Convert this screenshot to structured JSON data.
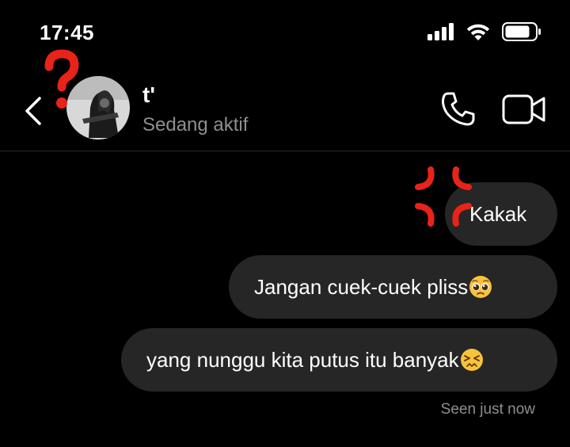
{
  "status_bar": {
    "time": "17:45"
  },
  "header": {
    "contact_name": "t'",
    "active_status": "Sedang aktif"
  },
  "messages": [
    {
      "text": "Kakak",
      "emoji": ""
    },
    {
      "text": "Jangan cuek-cuek pliss",
      "emoji": "pleading-face"
    },
    {
      "text": "yang nunggu kita putus itu banyak",
      "emoji": "persevering-face"
    }
  ],
  "seen_status": "Seen just now",
  "icons": {
    "back": "chevron-left-icon",
    "call": "phone-icon",
    "video": "video-camera-icon",
    "question_mark": "question-mark-icon",
    "anger": "anger-symbol-icon"
  },
  "colors": {
    "background": "#000000",
    "bubble": "#262626",
    "secondary_text": "#8e8e93",
    "sticker_red": "#e8231a"
  }
}
